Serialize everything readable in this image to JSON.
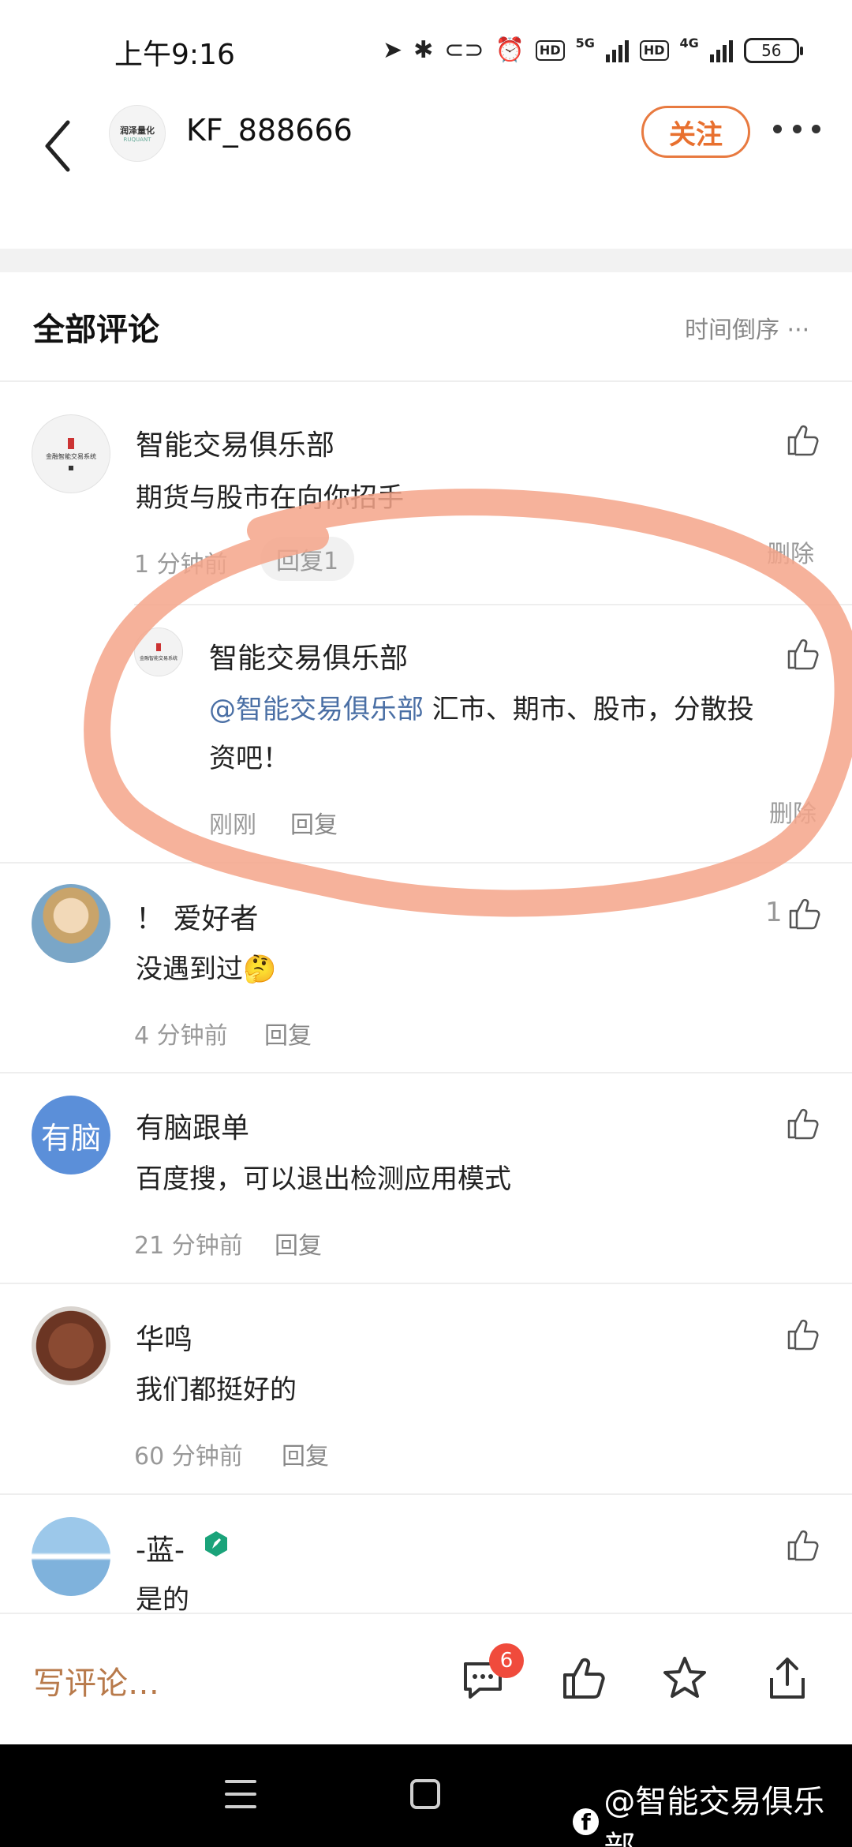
{
  "status_bar": {
    "time": "上午9:16",
    "net1": "5G",
    "net2": "4G",
    "hd": "HD",
    "battery": "56"
  },
  "header": {
    "title": "KF_888666",
    "follow_label": "关注",
    "avatar_text": "润泽量化",
    "avatar_sub": "RUQUANT"
  },
  "comments_section": {
    "title": "全部评论",
    "sort_label": "时间倒序 ···"
  },
  "comments": [
    {
      "name": "智能交易俱乐部",
      "text": "期货与股市在向你招手",
      "time": "1 分钟前",
      "reply_label": "回复1",
      "delete_label": "删除",
      "reply": {
        "name": "智能交易俱乐部",
        "mention": "@智能交易俱乐部",
        "text_line1": " 汇市、期市、股市，分散投",
        "text_line2": "资吧！",
        "time": "刚刚",
        "reply_label": "回复",
        "delete_label": "删除"
      }
    },
    {
      "name": "！ 爱好者",
      "text": "没遇到过🤔",
      "time": "4 分钟前",
      "reply_label": "回复",
      "like_count": "1"
    },
    {
      "name": "有脑跟单",
      "avatar_text": "有脑",
      "text": "百度搜，可以退出检测应用模式",
      "time": "21 分钟前",
      "reply_label": "回复"
    },
    {
      "name": "华鸣",
      "text": "我们都挺好的",
      "time": "60 分钟前",
      "reply_label": "回复"
    },
    {
      "name": "-蓝-",
      "text": "是的"
    }
  ],
  "bottom_bar": {
    "write_placeholder": "写评论…",
    "comment_count_badge": "6"
  },
  "watermark": "@智能交易俱乐部",
  "colors": {
    "accent": "#e8702f",
    "annotation": "#f4a58a",
    "mention": "#4a6fa5"
  }
}
